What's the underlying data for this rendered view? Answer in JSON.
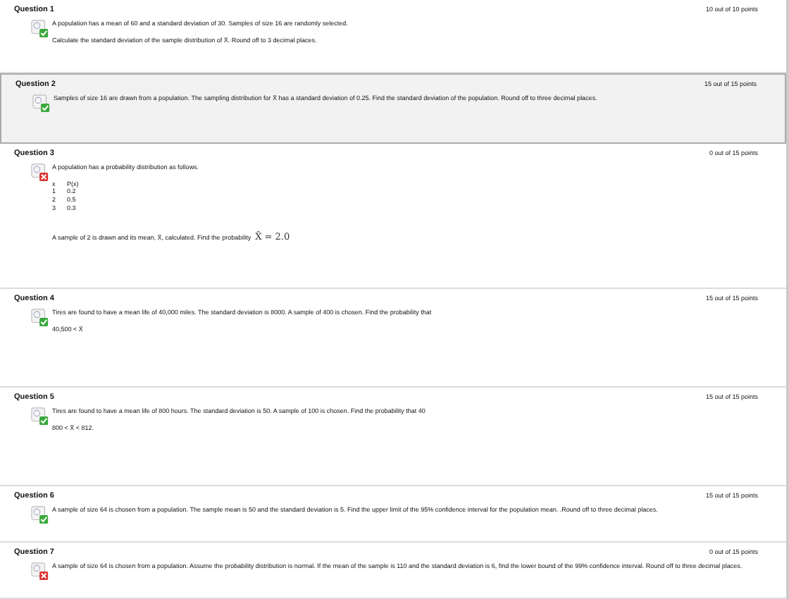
{
  "questions": [
    {
      "title": "Question 1",
      "points": "10 out of 10 points",
      "correct": true,
      "highlighted": false,
      "lines": [
        "A population has a mean of 60 and a standard deviation of 30. Samples of size 16 are randomly selected.",
        "Calculate the standard deviation of the sample distribution of X̄.  Round off to 3 decimal places."
      ]
    },
    {
      "title": "Question 2",
      "points": "15 out of 15 points",
      "correct": true,
      "highlighted": true,
      "lines": [
        "Samples of size 16 are drawn from a population.  The sampling distribution for X̄ has a standard deviation of 0.25. Find the standard deviation of the population. Round off to three decimal places."
      ]
    },
    {
      "title": "Question 3",
      "points": "0 out of 15 points",
      "correct": false,
      "highlighted": false,
      "lines": [
        "A population has a probability distribution as follows."
      ],
      "table": {
        "columns": [
          "x",
          "P(x)"
        ],
        "rows": [
          [
            "1",
            "0.2"
          ],
          [
            "2",
            "0.5"
          ],
          [
            "3",
            "0.3"
          ]
        ]
      },
      "closing": "A sample of 2 is drawn and its mean, X̄, calculated. Find the probability",
      "formula": "X̄ = 2.0"
    },
    {
      "title": "Question 4",
      "points": "15 out of 15 points",
      "correct": true,
      "highlighted": false,
      "lines": [
        "Tires are found to have a mean life of 40,000 miles. The standard deviation is 8000. A sample of 400 is chosen. Find the probability that",
        "40,500 < X̄"
      ]
    },
    {
      "title": "Question 5",
      "points": "15 out of 15 points",
      "correct": true,
      "highlighted": false,
      "lines": [
        "Tires are found to have a mean life of 800 hours. The standard deviation is 50. A sample of 100 is chosen. Find the probability that 40",
        "800 < X̄ < 812."
      ]
    },
    {
      "title": "Question 6",
      "points": "15 out of 15 points",
      "correct": true,
      "highlighted": false,
      "lines": [
        "A sample of size 64 is chosen from a population.  The sample mean is 50 and the standard deviation is 5. Find the upper limit of the 95% confidence interval for the population mean.  .Round off to three decimal places."
      ]
    },
    {
      "title": "Question 7",
      "points": "0 out of 15 points",
      "correct": false,
      "highlighted": false,
      "lines": [
        "A sample of size 64 is chosen from a population. Assume the probability distribution is normal.  If the mean of the sample is 110 and the standard deviation is 6, find the lower bound of the 99% confidence interval.  Round off to three decimal places."
      ]
    }
  ]
}
